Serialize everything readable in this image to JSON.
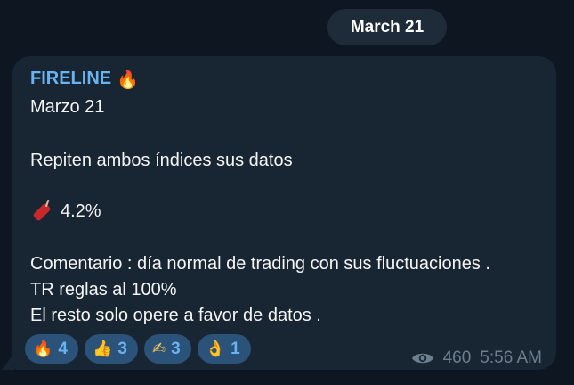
{
  "date_separator": "March 21",
  "message": {
    "sender": "FIRELINE",
    "sender_emoji": "🔥",
    "date_line": "Marzo 21",
    "line1": "Repiten ambos índices sus datos",
    "stat_icon": "dynamite-icon",
    "stat_value": "4.2%",
    "comment_line1": "Comentario : día normal de trading con sus fluctuaciones .",
    "comment_line2": "TR reglas al 100%",
    "comment_line3": "El resto solo opere a favor de datos .",
    "views": "460",
    "time": "5:56 AM"
  },
  "reactions": [
    {
      "emoji": "🔥",
      "icon": "fire-icon",
      "count": "4"
    },
    {
      "emoji": "👍",
      "icon": "thumbs-up-icon",
      "count": "3"
    },
    {
      "emoji": "✍",
      "icon": "writing-hand-icon",
      "count": "3"
    },
    {
      "emoji": "👌",
      "icon": "ok-hand-icon",
      "count": "1"
    }
  ],
  "colors": {
    "background": "#0e1621",
    "bubble": "#182533",
    "accent": "#6ab3f3",
    "reaction_bg": "#2b5278",
    "meta_text": "#6d7f8f"
  }
}
